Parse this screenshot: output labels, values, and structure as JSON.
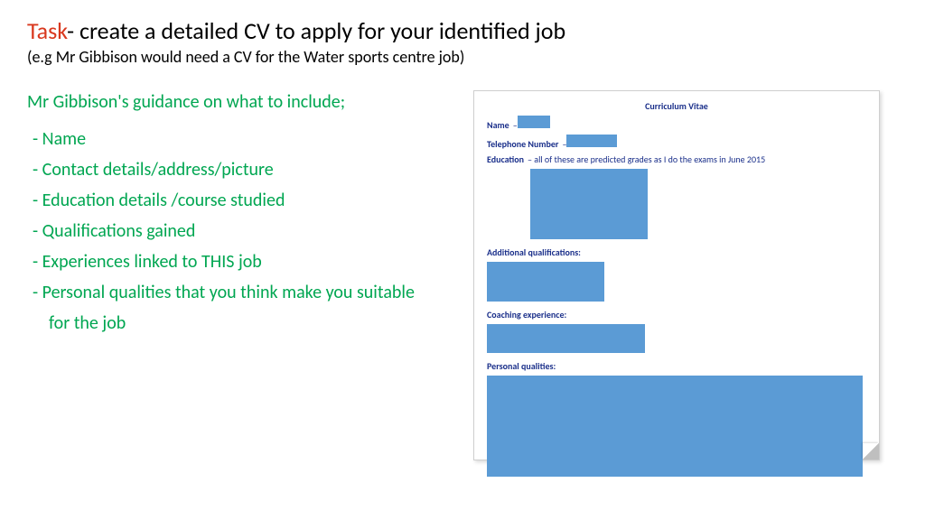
{
  "title": {
    "task_word": "Task",
    "rest": "- create a detailed CV to apply for your identified job"
  },
  "subtitle": "(e.g Mr Gibbison would need a CV for the Water sports centre job)",
  "guidance": {
    "heading": "Mr Gibbison's guidance on what to include;",
    "items": [
      "Name",
      "Contact details/address/picture",
      "Education details /course studied",
      "Qualifications gained",
      "Experiences linked to THIS job",
      "Personal qualities that you think make you suitable for the job"
    ]
  },
  "cv": {
    "heading": "Curriculum Vitae",
    "name_label": "Name",
    "phone_label": "Telephone Number",
    "education_label": "Education",
    "education_note": " – all of these are predicted grades as I do the exams in June 2015",
    "addq_label": "Additional qualifications:",
    "coach_label": "Coaching experience:",
    "pq_label": "Personal qualities:"
  }
}
